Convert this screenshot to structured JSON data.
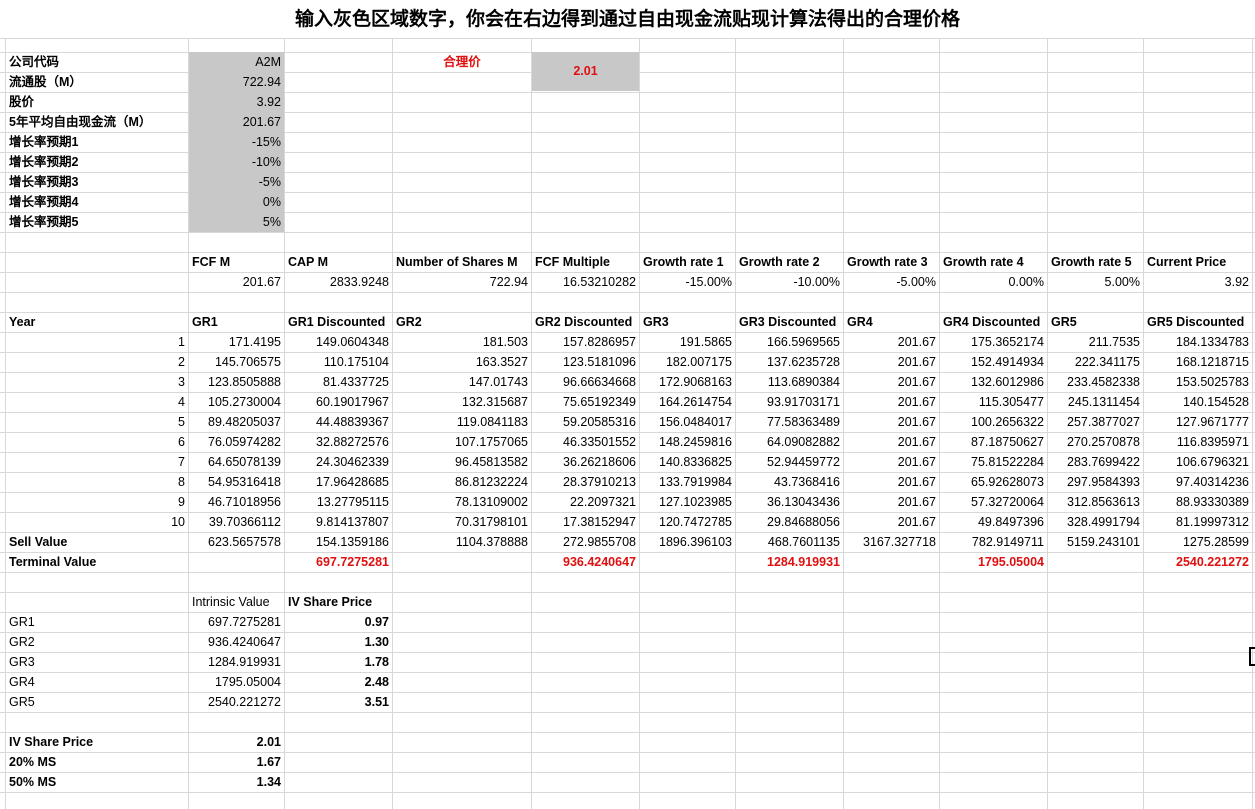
{
  "title": "输入灰色区域数字，你会在右边得到通过自由现金流贴现计算法得出的合理价格",
  "inputs": [
    {
      "label": "公司代码",
      "value": "A2M"
    },
    {
      "label": "流通股（M）",
      "value": "722.94"
    },
    {
      "label": "股价",
      "value": "3.92"
    },
    {
      "label": "5年平均自由现金流（M）",
      "value": "201.67"
    },
    {
      "label": "增长率预期1",
      "value": "-15%"
    },
    {
      "label": "增长率预期2",
      "value": "-10%"
    },
    {
      "label": "增长率预期3",
      "value": "-5%"
    },
    {
      "label": "增长率预期4",
      "value": "0%"
    },
    {
      "label": "增长率预期5",
      "value": "5%"
    }
  ],
  "fair_price": {
    "label": "合理价",
    "value": "2.01"
  },
  "summary": {
    "headers": [
      "FCF M",
      "CAP M",
      "Number of Shares M",
      "FCF Multiple",
      "Growth rate 1",
      "Growth rate 2",
      "Growth rate 3",
      "Growth rate 4",
      "Growth rate 5",
      "Current Price"
    ],
    "values": [
      "201.67",
      "2833.9248",
      "722.94",
      "16.53210282",
      "-15.00%",
      "-10.00%",
      "-5.00%",
      "0.00%",
      "5.00%",
      "3.92"
    ]
  },
  "projection": {
    "headers": [
      "Year",
      "GR1",
      "GR1 Discounted",
      "GR2",
      "GR2 Discounted",
      "GR3",
      "GR3 Discounted",
      "GR4",
      "GR4 Discounted",
      "GR5",
      "GR5 Discounted"
    ],
    "rows": [
      [
        "1",
        "171.4195",
        "149.0604348",
        "181.503",
        "157.8286957",
        "191.5865",
        "166.5969565",
        "201.67",
        "175.3652174",
        "211.7535",
        "184.1334783"
      ],
      [
        "2",
        "145.706575",
        "110.175104",
        "163.3527",
        "123.5181096",
        "182.007175",
        "137.6235728",
        "201.67",
        "152.4914934",
        "222.341175",
        "168.1218715"
      ],
      [
        "3",
        "123.8505888",
        "81.4337725",
        "147.01743",
        "96.66634668",
        "172.9068163",
        "113.6890384",
        "201.67",
        "132.6012986",
        "233.4582338",
        "153.5025783"
      ],
      [
        "4",
        "105.2730004",
        "60.19017967",
        "132.315687",
        "75.65192349",
        "164.2614754",
        "93.91703171",
        "201.67",
        "115.305477",
        "245.1311454",
        "140.154528"
      ],
      [
        "5",
        "89.48205037",
        "44.48839367",
        "119.0841183",
        "59.20585316",
        "156.0484017",
        "77.58363489",
        "201.67",
        "100.2656322",
        "257.3877027",
        "127.9671777"
      ],
      [
        "6",
        "76.05974282",
        "32.88272576",
        "107.1757065",
        "46.33501552",
        "148.2459816",
        "64.09082882",
        "201.67",
        "87.18750627",
        "270.2570878",
        "116.8395971"
      ],
      [
        "7",
        "64.65078139",
        "24.30462339",
        "96.45813582",
        "36.26218606",
        "140.8336825",
        "52.94459772",
        "201.67",
        "75.81522284",
        "283.7699422",
        "106.6796321"
      ],
      [
        "8",
        "54.95316418",
        "17.96428685",
        "86.81232224",
        "28.37910213",
        "133.7919984",
        "43.7368416",
        "201.67",
        "65.92628073",
        "297.9584393",
        "97.40314236"
      ],
      [
        "9",
        "46.71018956",
        "13.27795115",
        "78.13109002",
        "22.2097321",
        "127.1023985",
        "36.13043436",
        "201.67",
        "57.32720064",
        "312.8563613",
        "88.93330389"
      ],
      [
        "10",
        "39.70366112",
        "9.814137807",
        "70.31798101",
        "17.38152947",
        "120.7472785",
        "29.84688056",
        "201.67",
        "49.8497396",
        "328.4991794",
        "81.19997312"
      ]
    ],
    "sell_value": {
      "label": "Sell Value",
      "values": [
        "623.5657578",
        "154.1359186",
        "1104.378888",
        "272.9855708",
        "1896.396103",
        "468.7601135",
        "3167.327718",
        "782.9149711",
        "5159.243101",
        "1275.28599"
      ]
    },
    "terminal_value": {
      "label": "Terminal Value",
      "values": [
        "697.7275281",
        "936.4240647",
        "1284.919931",
        "1795.05004",
        "2540.221272"
      ]
    }
  },
  "intrinsic": {
    "headers": [
      "Intrinsic Value",
      "IV Share Price"
    ],
    "rows": [
      [
        "GR1",
        "697.7275281",
        "0.97"
      ],
      [
        "GR2",
        "936.4240647",
        "1.30"
      ],
      [
        "GR3",
        "1284.919931",
        "1.78"
      ],
      [
        "GR4",
        "1795.05004",
        "2.48"
      ],
      [
        "GR5",
        "2540.221272",
        "3.51"
      ]
    ]
  },
  "margin_of_safety": [
    {
      "label": "IV Share Price",
      "value": "2.01"
    },
    {
      "label": "20% MS",
      "value": "1.67"
    },
    {
      "label": "50% MS",
      "value": "1.34"
    }
  ],
  "colors": {
    "input_fill": "#c8c8c8",
    "accent_red": "#e01010",
    "gridline": "#d8d8d8"
  }
}
